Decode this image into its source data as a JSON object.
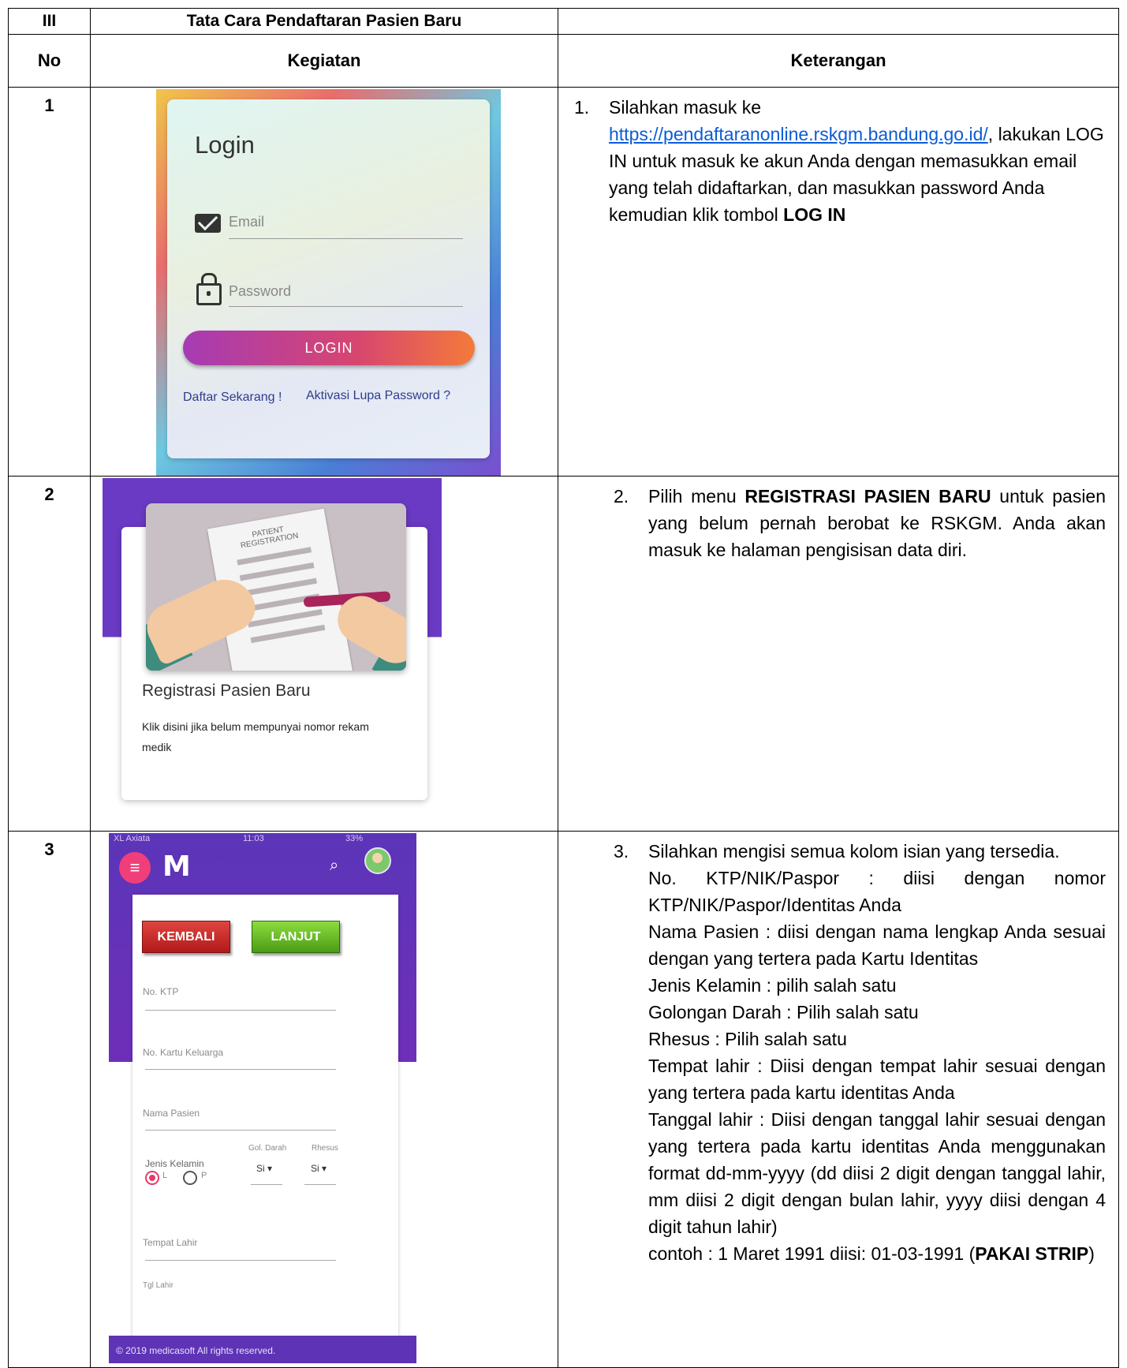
{
  "header": {
    "section": "III",
    "title": "Tata Cara Pendaftaran Pasien Baru"
  },
  "columns": {
    "no": "No",
    "activity": "Kegiatan",
    "notes": "Keterangan"
  },
  "rows": [
    {
      "no": "1",
      "login": {
        "title": "Login",
        "email_placeholder": "Email",
        "password_placeholder": "Password",
        "login_button": "LOGIN",
        "register_link": "Daftar Sekarang !",
        "forgot_link": "Aktivasi Lupa Password ?"
      },
      "desc": {
        "num": "1.",
        "pre": "Silahkan masuk ke",
        "url": "https://pendaftaranonline.rskgm.bandung.go.id/",
        "comma": ",",
        "body": "lakukan LOG IN untuk masuk ke akun Anda dengan memasukkan email yang telah didaftarkan, dan masukkan password Anda kemudian klik tombol",
        "bold": "LOG IN"
      }
    },
    {
      "no": "2",
      "reg": {
        "paper_title": "PATIENT REGISTRATION",
        "title": "Registrasi Pasien Baru",
        "desc": "Klik disini jika belum mempunyai nomor rekam medik"
      },
      "desc": {
        "num": "2.",
        "pre": "Pilih menu",
        "bold": "REGISTRASI PASIEN BARU",
        "post": "untuk pasien yang belum pernah berobat ke RSKGM. Anda akan masuk ke halaman pengisisan data diri."
      }
    },
    {
      "no": "3",
      "form": {
        "status_carrier": "XL Axiata",
        "status_time": "11:03",
        "status_battery": "33%",
        "logo": "M",
        "back_button": "KEMBALI",
        "next_button": "LANJUT",
        "ktp_label": "No. KTP",
        "kk_label": "No. Kartu Keluarga",
        "name_label": "Nama Pasien",
        "gender_label": "Jenis Kelamin",
        "gender_l": "L",
        "gender_p": "P",
        "blood_label": "Gol. Darah",
        "blood_value": "Si ▾",
        "rhesus_label": "Rhesus",
        "rhesus_value": "Si ▾",
        "birthplace_label": "Tempat Lahir",
        "dob_label": "Tgl Lahir",
        "footer": "© 2019 medicasoft All rights reserved."
      },
      "desc": {
        "num": "3.",
        "intro": "Silahkan mengisi semua kolom isian yang tersedia.",
        "ktp": "No. KTP/NIK/Paspor      : diisi dengan nomor KTP/NIK/Paspor/Identitas Anda",
        "name": "Nama Pasien     : diisi dengan nama lengkap Anda sesuai dengan yang tertera pada Kartu Identitas",
        "gender": "Jenis Kelamin    : pilih salah satu",
        "blood": "Golongan Darah : Pilih salah satu",
        "rhesus": "Rhesus  : Pilih salah satu",
        "birthplace": "Tempat lahir      : Diisi dengan tempat lahir sesuai dengan yang tertera pada kartu identitas Anda",
        "dob": "Tanggal lahir      : Diisi dengan tanggal lahir sesuai dengan yang tertera pada kartu identitas Anda menggunakan format dd-mm-yyyy (dd diisi 2 digit dengan tanggal lahir, mm diisi 2 digit dengan bulan lahir, yyyy diisi dengan 4 digit tahun lahir)",
        "example": "contoh : 1 Maret 1991 diisi: 01-03-1991 (",
        "example_bold": "PAKAI STRIP",
        "example_end": ")"
      }
    }
  ]
}
